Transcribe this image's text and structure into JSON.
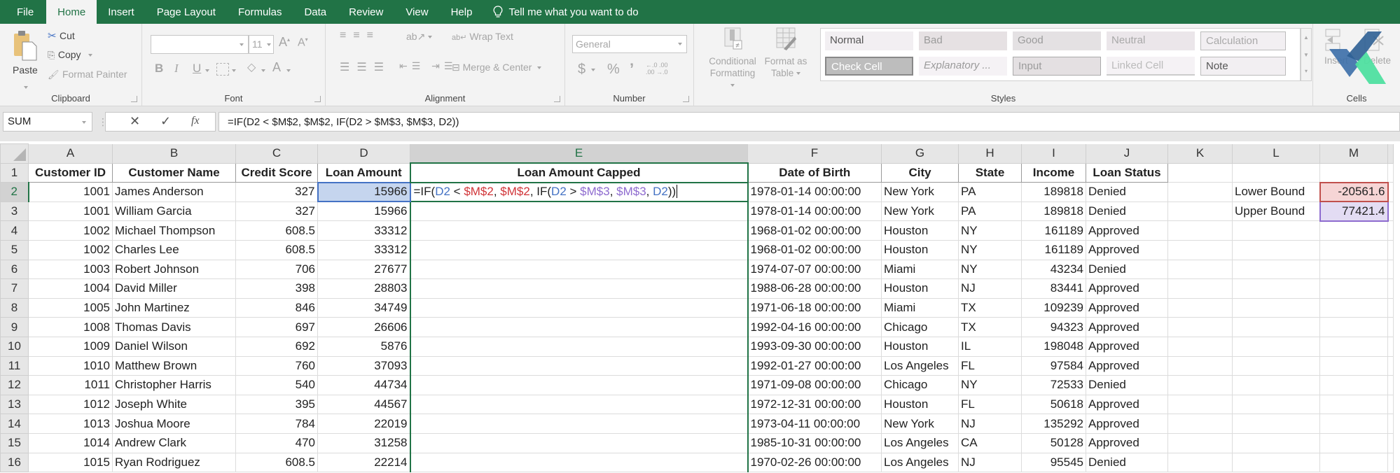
{
  "ribbon_tabs": [
    "File",
    "Home",
    "Insert",
    "Page Layout",
    "Formulas",
    "Data",
    "Review",
    "View",
    "Help"
  ],
  "active_tab": "Home",
  "tell_me": "Tell me what you want to do",
  "clipboard": {
    "paste": "Paste",
    "cut": "Cut",
    "copy": "Copy",
    "format_painter": "Format Painter",
    "label": "Clipboard"
  },
  "font": {
    "name": "",
    "size": "11",
    "label": "Font",
    "bold": "B",
    "italic": "I",
    "underline": "U",
    "font_color": "A",
    "grow": "A",
    "shrink": "A"
  },
  "alignment": {
    "wrap_text": "Wrap Text",
    "merge_center": "Merge & Center",
    "label": "Alignment"
  },
  "number": {
    "format": "General",
    "currency": "$",
    "percent": "%",
    "comma": "’",
    "inc_decimal": "←.0 .00",
    "dec_decimal": ".00 →.0",
    "label": "Number"
  },
  "styles": {
    "conditional_formatting": [
      "Conditional",
      "Formatting"
    ],
    "format_as_table": [
      "Format as",
      "Table"
    ],
    "cells": [
      {
        "name": "Normal"
      },
      {
        "name": "Bad"
      },
      {
        "name": "Good"
      },
      {
        "name": "Neutral"
      },
      {
        "name": "Calculation"
      },
      {
        "name": "Check Cell"
      },
      {
        "name": "Explanatory ..."
      },
      {
        "name": "Input"
      },
      {
        "name": "Linked Cell"
      },
      {
        "name": "Note"
      }
    ],
    "label": "Styles"
  },
  "cells_group": {
    "insert": "Insert",
    "delete": "Delete",
    "label": "Cells"
  },
  "formula_bar": {
    "name_box": "SUM",
    "fx": "fx",
    "formula": "=IF(D2 < $M$2, $M$2, IF(D2 > $M$3, $M$3, D2))"
  },
  "sheet": {
    "columns": [
      "A",
      "B",
      "C",
      "D",
      "E",
      "F",
      "G",
      "H",
      "I",
      "J",
      "K",
      "L",
      "M"
    ],
    "selected_column": "E",
    "selected_row": 2,
    "headers": [
      "Customer ID",
      "Customer Name",
      "Credit Score",
      "Loan Amount",
      "Loan Amount Capped",
      "Date of Birth",
      "City",
      "State",
      "Income",
      "Loan Status"
    ],
    "editing_formula_parts": [
      {
        "t": "=IF(",
        "c": ""
      },
      {
        "t": "D2",
        "c": "blue"
      },
      {
        "t": " < ",
        "c": ""
      },
      {
        "t": "$M$2",
        "c": "red"
      },
      {
        "t": ", ",
        "c": ""
      },
      {
        "t": "$M$2",
        "c": "red"
      },
      {
        "t": ", IF(",
        "c": ""
      },
      {
        "t": "D2",
        "c": "blue"
      },
      {
        "t": " > ",
        "c": ""
      },
      {
        "t": "$M$3",
        "c": "purple"
      },
      {
        "t": ", ",
        "c": ""
      },
      {
        "t": "$M$3",
        "c": "purple"
      },
      {
        "t": ", ",
        "c": ""
      },
      {
        "t": "D2",
        "c": "blue"
      },
      {
        "t": "))",
        "c": ""
      }
    ],
    "rows": [
      [
        "1001",
        "James Anderson",
        "327",
        "15966",
        "",
        "1978-01-14 00:00:00",
        "New York",
        "PA",
        "189818",
        "Denied"
      ],
      [
        "1001",
        "William Garcia",
        "327",
        "15966",
        "",
        "1978-01-14 00:00:00",
        "New York",
        "PA",
        "189818",
        "Denied"
      ],
      [
        "1002",
        "Michael Thompson",
        "608.5",
        "33312",
        "",
        "1968-01-02 00:00:00",
        "Houston",
        "NY",
        "161189",
        "Approved"
      ],
      [
        "1002",
        "Charles Lee",
        "608.5",
        "33312",
        "",
        "1968-01-02 00:00:00",
        "Houston",
        "NY",
        "161189",
        "Approved"
      ],
      [
        "1003",
        "Robert Johnson",
        "706",
        "27677",
        "",
        "1974-07-07 00:00:00",
        "Miami",
        "NY",
        "43234",
        "Denied"
      ],
      [
        "1004",
        "David Miller",
        "398",
        "28803",
        "",
        "1988-06-28 00:00:00",
        "Houston",
        "NJ",
        "83441",
        "Approved"
      ],
      [
        "1005",
        "John Martinez",
        "846",
        "34749",
        "",
        "1971-06-18 00:00:00",
        "Miami",
        "TX",
        "109239",
        "Approved"
      ],
      [
        "1008",
        "Thomas Davis",
        "697",
        "26606",
        "",
        "1992-04-16 00:00:00",
        "Chicago",
        "TX",
        "94323",
        "Approved"
      ],
      [
        "1009",
        "Daniel Wilson",
        "692",
        "5876",
        "",
        "1993-09-30 00:00:00",
        "Houston",
        "IL",
        "198048",
        "Approved"
      ],
      [
        "1010",
        "Matthew Brown",
        "760",
        "37093",
        "",
        "1992-01-27 00:00:00",
        "Los Angeles",
        "FL",
        "97584",
        "Approved"
      ],
      [
        "1011",
        "Christopher Harris",
        "540",
        "44734",
        "",
        "1971-09-08 00:00:00",
        "Chicago",
        "NY",
        "72533",
        "Denied"
      ],
      [
        "1012",
        "Joseph White",
        "395",
        "44567",
        "",
        "1972-12-31 00:00:00",
        "Houston",
        "FL",
        "50618",
        "Approved"
      ],
      [
        "1013",
        "Joshua Moore",
        "784",
        "22019",
        "",
        "1973-04-11 00:00:00",
        "New York",
        "NJ",
        "135292",
        "Approved"
      ],
      [
        "1014",
        "Andrew Clark",
        "470",
        "31258",
        "",
        "1985-10-31 00:00:00",
        "Los Angeles",
        "CA",
        "50128",
        "Approved"
      ],
      [
        "1015",
        "Ryan Rodriguez",
        "608.5",
        "22214",
        "",
        "1970-02-26 00:00:00",
        "Los Angeles",
        "NJ",
        "95545",
        "Denied"
      ]
    ],
    "bounds": {
      "lower_label": "Lower Bound",
      "lower_value": "-20561.6",
      "upper_label": "Upper Bound",
      "upper_value": "77421.4"
    }
  }
}
